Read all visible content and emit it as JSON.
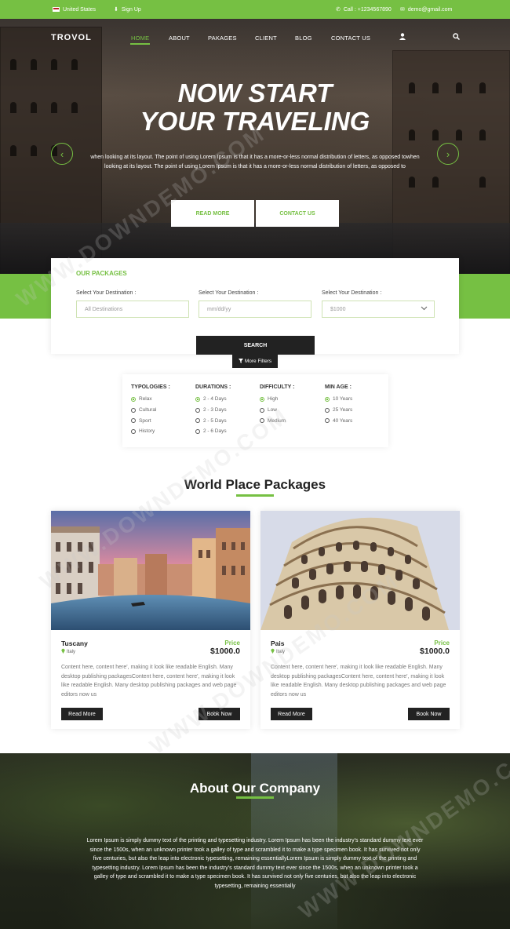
{
  "topbar": {
    "country": "United States",
    "signup": "Sign Up",
    "call": "Call : +1234567890",
    "email": "demo@gmail.com"
  },
  "nav": {
    "logo": "TROVOL",
    "items": [
      "HOME",
      "ABOUT",
      "PAKAGES",
      "CLIENT",
      "BLOG",
      "CONTACT US"
    ]
  },
  "hero": {
    "title_line1": "NOW START",
    "title_line2": "YOUR TRAVELING",
    "text": "when looking at its layout. The point of using Lorem Ipsum is that it has a more-or-less normal distribution of letters, as opposed towhen looking at its layout. The point of using Lorem Ipsum is that it has a more-or-less normal distribution of letters, as opposed to",
    "read_more": "READ MORE",
    "contact_us": "CONTACT US"
  },
  "search": {
    "heading": "OUR PACKAGES",
    "label1": "Select Your Destination :",
    "label2": "Select Your Destination :",
    "label3": "Select Your Destination :",
    "placeholder1": "All Destinations",
    "placeholder2": "mm/dd/yy",
    "placeholder3": "$1000",
    "search_btn": "SEARCH",
    "more_filters": "More Filters"
  },
  "filters": {
    "typologies": {
      "title": "TYPOLOGIES :",
      "options": [
        "Relax",
        "Cultural",
        "Sport",
        "History"
      ]
    },
    "durations": {
      "title": "DURATIONS :",
      "options": [
        "2 - 4 Days",
        "2 - 3 Days",
        "2 - 5 Days",
        "2 - 6 Days"
      ]
    },
    "difficulty": {
      "title": "DIFFICULTY :",
      "options": [
        "High",
        "Low",
        "Medium"
      ]
    },
    "min_age": {
      "title": "MIN AGE :",
      "options": [
        "10 Years",
        "25 Years",
        "40 Years"
      ]
    }
  },
  "packages": {
    "title": "World Place Packages",
    "cards": [
      {
        "name": "Tuscany",
        "location": "Italy",
        "price_label": "Price",
        "price": "$1000.0",
        "desc": "Content here, content here', making it look like readable English. Many desktop publishing packagesContent here, content here', making it look like readable English. Many desktop publishing packages and web page editors now us",
        "read_more": "Read More",
        "book_now": "Book Now"
      },
      {
        "name": "Pais",
        "location": "Italy",
        "price_label": "Price",
        "price": "$1000.0",
        "desc": "Content here, content here', making it look like readable English. Many desktop publishing packagesContent here, content here', making it look like readable English. Many desktop publishing packages and web page editors now us",
        "read_more": "Read More",
        "book_now": "Book Now"
      }
    ]
  },
  "about": {
    "title": "About Our Company",
    "text": "Lorem Ipsum is simply dummy text of the printing and typesetting industry. Lorem Ipsum has been the industry's standard dummy text ever since the 1500s, when an unknown printer took a galley of type and scrambled it to make a type specimen book. It has survived not only five centuries, but also the leap into electronic typesetting, remaining essentiallyLorem Ipsum is simply dummy text of the printing and typesetting industry. Lorem Ipsum has been the industry's standard dummy text ever since the 1500s, when an unknown printer took a galley of type and scrambled it to make a type specimen book. It has survived not only five centuries, but also the leap into electronic typesetting, remaining essentially"
  },
  "watermark": "WWW.DOWNDEMO.COM",
  "colors": {
    "accent": "#76c043",
    "dark": "#222222"
  }
}
